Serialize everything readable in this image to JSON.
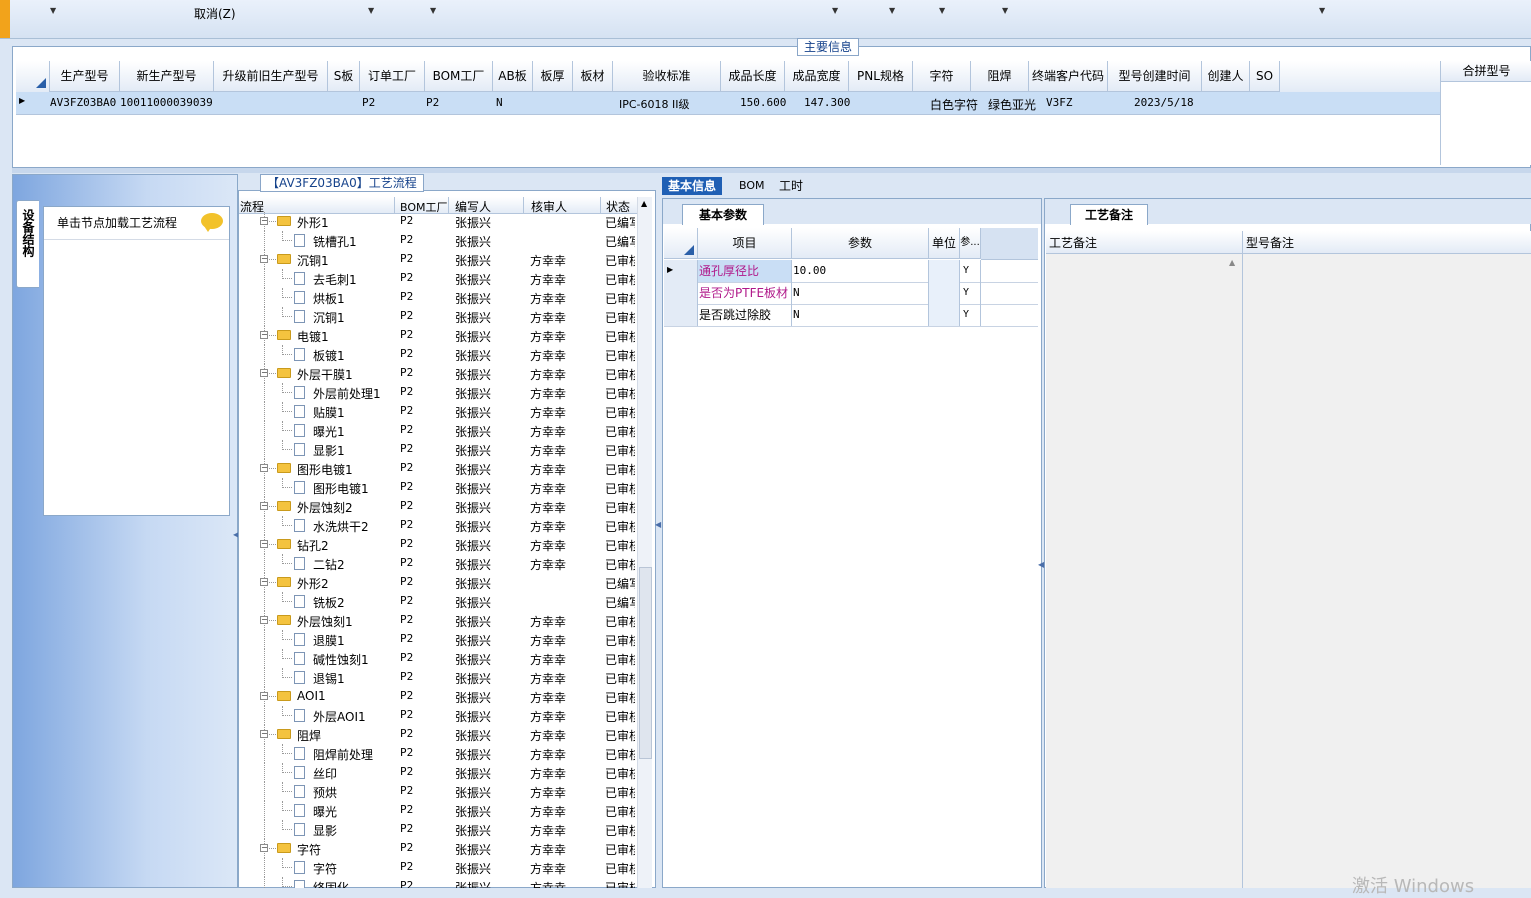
{
  "toolbar": {
    "cancel_label": "取消(Z)"
  },
  "main_info": {
    "section_title": "主要信息",
    "columns": [
      "生产型号",
      "新生产型号",
      "升级前旧生产型号",
      "S板",
      "订单工厂",
      "BOM工厂",
      "AB板",
      "板厚",
      "板材",
      "验收标准",
      "成品长度",
      "成品宽度",
      "PNL规格",
      "字符",
      "阻焊",
      "终端客户代码",
      "型号创建时间",
      "创建人",
      "SO"
    ],
    "row": {
      "prod_model": "AV3FZ03BA0",
      "new_prod_model": "10011000039039",
      "order_factory": "P2",
      "bom_factory": "P2",
      "ab_board": "N",
      "standard": "IPC-6018 II级",
      "length": "150.600",
      "width": "147.300",
      "char": "白色字符",
      "solder": "绿色亚光",
      "client_code": "V3FZ",
      "created": "2023/5/18"
    },
    "merge_label": "合拼型号"
  },
  "left_panel": {
    "vertical_tab": "设备结构",
    "hint": "单击节点加载工艺流程"
  },
  "process": {
    "title": "【AV3FZ03BA0】工艺流程",
    "columns": [
      "流程",
      "BOM工厂",
      "编写人",
      "核审人",
      "状态"
    ],
    "rows": [
      {
        "name": "外形1",
        "level": 0,
        "factory": "P2",
        "author": "张振兴",
        "reviewer": "",
        "status": "已编写"
      },
      {
        "name": "铣槽孔1",
        "level": 1,
        "factory": "P2",
        "author": "张振兴",
        "reviewer": "",
        "status": "已编写"
      },
      {
        "name": "沉铜1",
        "level": 0,
        "factory": "P2",
        "author": "张振兴",
        "reviewer": "方幸幸",
        "status": "已审核"
      },
      {
        "name": "去毛刺1",
        "level": 1,
        "factory": "P2",
        "author": "张振兴",
        "reviewer": "方幸幸",
        "status": "已审核"
      },
      {
        "name": "烘板1",
        "level": 1,
        "factory": "P2",
        "author": "张振兴",
        "reviewer": "方幸幸",
        "status": "已审核"
      },
      {
        "name": "沉铜1",
        "level": 1,
        "factory": "P2",
        "author": "张振兴",
        "reviewer": "方幸幸",
        "status": "已审核"
      },
      {
        "name": "电镀1",
        "level": 0,
        "factory": "P2",
        "author": "张振兴",
        "reviewer": "方幸幸",
        "status": "已审核"
      },
      {
        "name": "板镀1",
        "level": 1,
        "factory": "P2",
        "author": "张振兴",
        "reviewer": "方幸幸",
        "status": "已审核"
      },
      {
        "name": "外层干膜1",
        "level": 0,
        "factory": "P2",
        "author": "张振兴",
        "reviewer": "方幸幸",
        "status": "已审核"
      },
      {
        "name": "外层前处理1",
        "level": 1,
        "factory": "P2",
        "author": "张振兴",
        "reviewer": "方幸幸",
        "status": "已审核"
      },
      {
        "name": "贴膜1",
        "level": 1,
        "factory": "P2",
        "author": "张振兴",
        "reviewer": "方幸幸",
        "status": "已审核"
      },
      {
        "name": "曝光1",
        "level": 1,
        "factory": "P2",
        "author": "张振兴",
        "reviewer": "方幸幸",
        "status": "已审核"
      },
      {
        "name": "显影1",
        "level": 1,
        "factory": "P2",
        "author": "张振兴",
        "reviewer": "方幸幸",
        "status": "已审核"
      },
      {
        "name": "图形电镀1",
        "level": 0,
        "factory": "P2",
        "author": "张振兴",
        "reviewer": "方幸幸",
        "status": "已审核"
      },
      {
        "name": "图形电镀1",
        "level": 1,
        "factory": "P2",
        "author": "张振兴",
        "reviewer": "方幸幸",
        "status": "已审核"
      },
      {
        "name": "外层蚀刻2",
        "level": 0,
        "factory": "P2",
        "author": "张振兴",
        "reviewer": "方幸幸",
        "status": "已审核"
      },
      {
        "name": "水洗烘干2",
        "level": 1,
        "factory": "P2",
        "author": "张振兴",
        "reviewer": "方幸幸",
        "status": "已审核"
      },
      {
        "name": "钻孔2",
        "level": 0,
        "factory": "P2",
        "author": "张振兴",
        "reviewer": "方幸幸",
        "status": "已审核"
      },
      {
        "name": "二钻2",
        "level": 1,
        "factory": "P2",
        "author": "张振兴",
        "reviewer": "方幸幸",
        "status": "已审核"
      },
      {
        "name": "外形2",
        "level": 0,
        "factory": "P2",
        "author": "张振兴",
        "reviewer": "",
        "status": "已编写"
      },
      {
        "name": "铣板2",
        "level": 1,
        "factory": "P2",
        "author": "张振兴",
        "reviewer": "",
        "status": "已编写"
      },
      {
        "name": "外层蚀刻1",
        "level": 0,
        "factory": "P2",
        "author": "张振兴",
        "reviewer": "方幸幸",
        "status": "已审核"
      },
      {
        "name": "退膜1",
        "level": 1,
        "factory": "P2",
        "author": "张振兴",
        "reviewer": "方幸幸",
        "status": "已审核"
      },
      {
        "name": "碱性蚀刻1",
        "level": 1,
        "factory": "P2",
        "author": "张振兴",
        "reviewer": "方幸幸",
        "status": "已审核"
      },
      {
        "name": "退锡1",
        "level": 1,
        "factory": "P2",
        "author": "张振兴",
        "reviewer": "方幸幸",
        "status": "已审核"
      },
      {
        "name": "AOI1",
        "level": 0,
        "factory": "P2",
        "author": "张振兴",
        "reviewer": "方幸幸",
        "status": "已审核"
      },
      {
        "name": "外层AOI1",
        "level": 1,
        "factory": "P2",
        "author": "张振兴",
        "reviewer": "方幸幸",
        "status": "已审核"
      },
      {
        "name": "阻焊",
        "level": 0,
        "factory": "P2",
        "author": "张振兴",
        "reviewer": "方幸幸",
        "status": "已审核"
      },
      {
        "name": "阻焊前处理",
        "level": 1,
        "factory": "P2",
        "author": "张振兴",
        "reviewer": "方幸幸",
        "status": "已审核"
      },
      {
        "name": "丝印",
        "level": 1,
        "factory": "P2",
        "author": "张振兴",
        "reviewer": "方幸幸",
        "status": "已审核"
      },
      {
        "name": "预烘",
        "level": 1,
        "factory": "P2",
        "author": "张振兴",
        "reviewer": "方幸幸",
        "status": "已审核"
      },
      {
        "name": "曝光",
        "level": 1,
        "factory": "P2",
        "author": "张振兴",
        "reviewer": "方幸幸",
        "status": "已审核"
      },
      {
        "name": "显影",
        "level": 1,
        "factory": "P2",
        "author": "张振兴",
        "reviewer": "方幸幸",
        "status": "已审核"
      },
      {
        "name": "字符",
        "level": 0,
        "factory": "P2",
        "author": "张振兴",
        "reviewer": "方幸幸",
        "status": "已审核"
      },
      {
        "name": "字符",
        "level": 1,
        "factory": "P2",
        "author": "张振兴",
        "reviewer": "方幸幸",
        "status": "已审核"
      },
      {
        "name": "终固化",
        "level": 1,
        "factory": "P2",
        "author": "张振兴",
        "reviewer": "方幸幸",
        "status": "已审核"
      }
    ]
  },
  "right_tabs": [
    "基本信息",
    "BOM",
    "工时"
  ],
  "basic_params": {
    "tab": "基本参数",
    "columns": [
      "项目",
      "参数",
      "单位",
      "参..."
    ],
    "rows": [
      {
        "item": "通孔厚径比",
        "value": "10.00",
        "unit": "",
        "flag": "Y"
      },
      {
        "item": "是否为PTFE板材",
        "value": "N",
        "unit": "",
        "flag": "Y"
      },
      {
        "item": "是否跳过除胶",
        "value": "N",
        "unit": "",
        "flag": "Y"
      }
    ]
  },
  "remarks": {
    "tab": "工艺备注",
    "process_remark": "工艺备注",
    "model_remark": "型号备注"
  },
  "watermark": "激活 Windows"
}
